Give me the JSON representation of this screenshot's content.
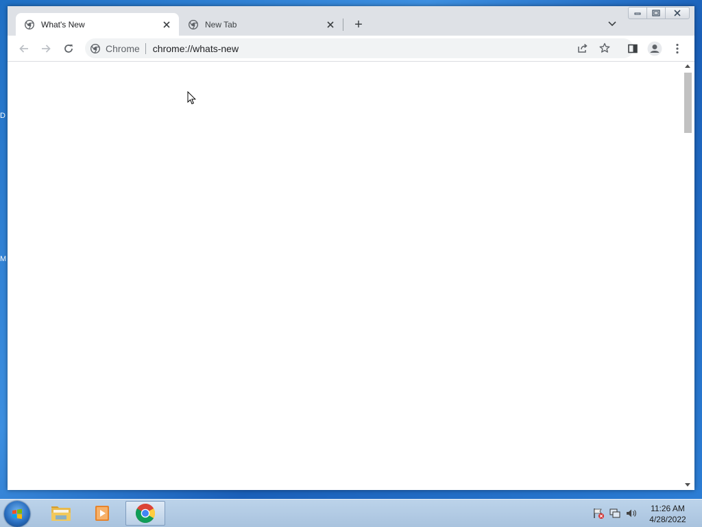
{
  "desktop": {
    "edge_letters": [
      "D",
      "M"
    ]
  },
  "browser": {
    "tabs": [
      {
        "label": "What's New",
        "active": true
      },
      {
        "label": "New Tab",
        "active": false
      }
    ],
    "new_tab_symbol": "+",
    "omnibox": {
      "chip_label": "Chrome",
      "url": "chrome://whats-new"
    },
    "window_controls": [
      "minimize",
      "restore",
      "close"
    ]
  },
  "taskbar": {
    "pinned": [
      "windows-explorer",
      "media-player",
      "chrome"
    ],
    "active_app": "chrome",
    "clock": {
      "time": "11:26 AM",
      "date": "4/28/2022"
    }
  },
  "colors": {
    "tabstrip_bg": "#dee1e6",
    "omnibox_bg": "#f1f3f4",
    "desktop_blue": "#2d7fd6",
    "taskbar_bg": "#bcd3ea"
  }
}
